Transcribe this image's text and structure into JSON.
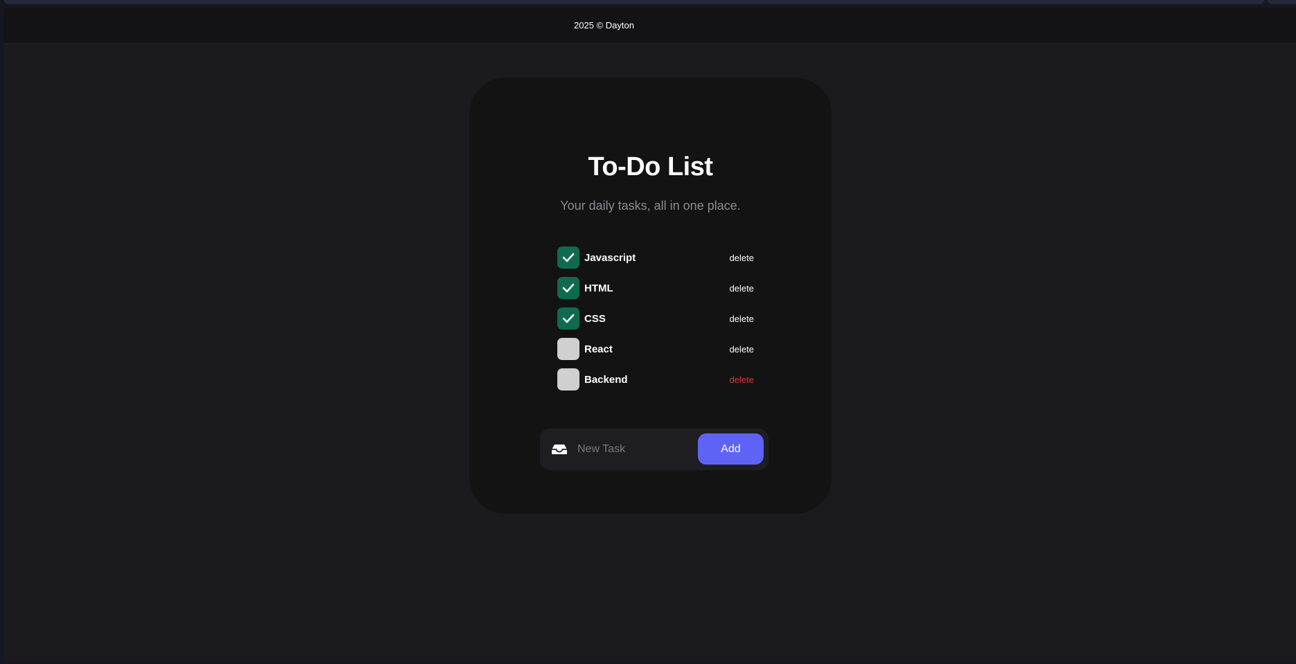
{
  "footer": {
    "text": "2025 © Dayton"
  },
  "card": {
    "title": "To-Do List",
    "subtitle": "Your daily tasks, all in one place."
  },
  "tasks": [
    {
      "label": "Javascript",
      "done": true,
      "delete_label": "delete"
    },
    {
      "label": "HTML",
      "done": true,
      "delete_label": "delete"
    },
    {
      "label": "CSS",
      "done": true,
      "delete_label": "delete"
    },
    {
      "label": "React",
      "done": false,
      "delete_label": "delete"
    },
    {
      "label": "Backend",
      "done": false,
      "delete_label": "delete",
      "hovered": true
    }
  ],
  "new_task": {
    "icon": "inbox-icon",
    "placeholder": "New Task",
    "value": "",
    "add_label": "Add"
  },
  "colors": {
    "done_check": "#0f6b4f",
    "undone_check": "#d0d0d0",
    "delete_hover": "#d9393b",
    "add_button": "#5e63f6"
  }
}
